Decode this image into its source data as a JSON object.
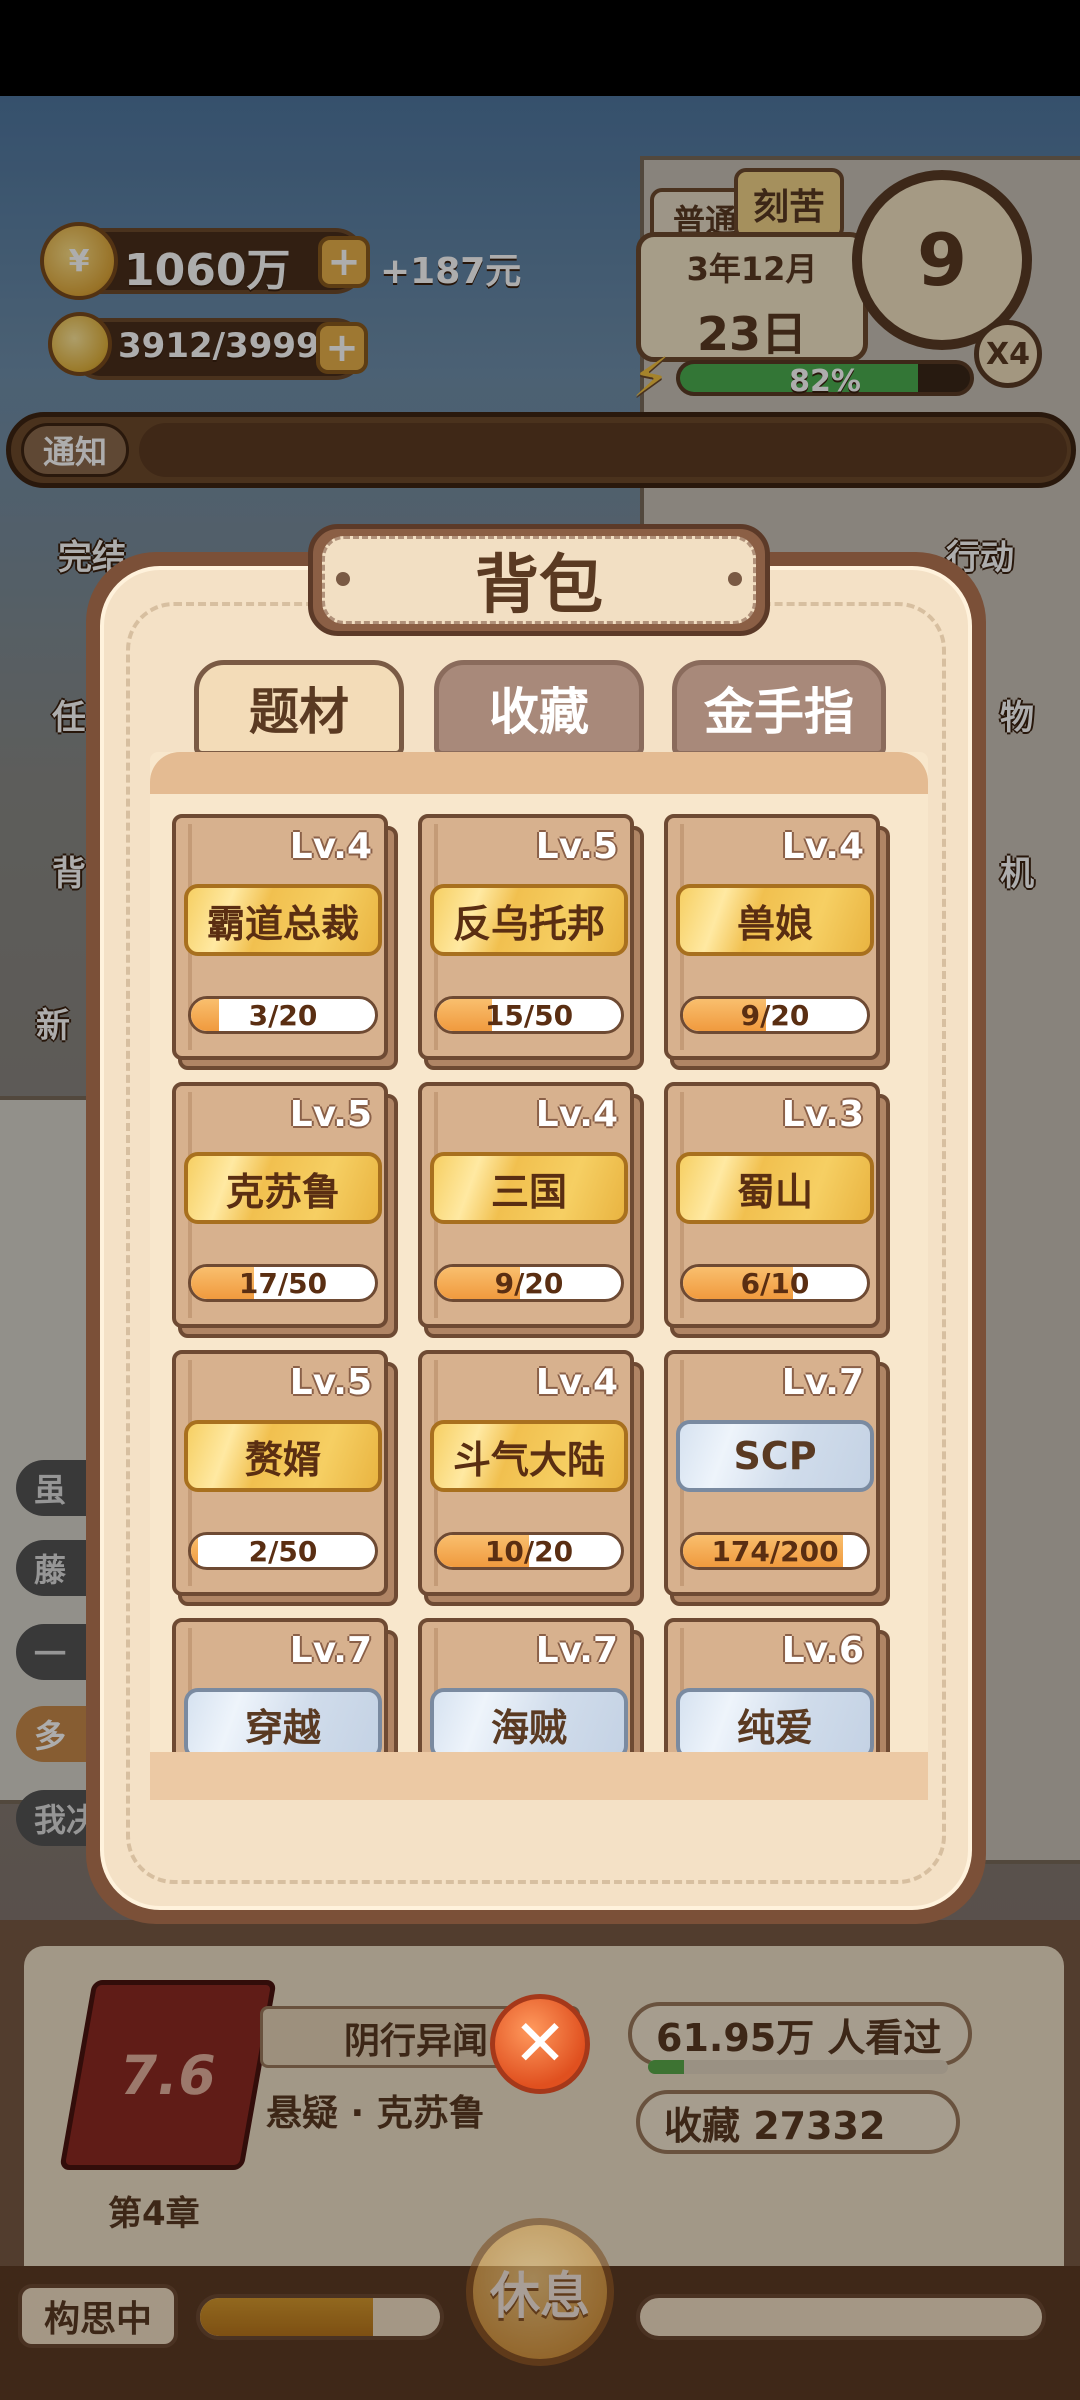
{
  "hud": {
    "money": "1060万",
    "money_plus": "+",
    "income": "+187元",
    "inspiration": "3912/3999",
    "inspiration_plus": "+"
  },
  "date_panel": {
    "mode_tab": "普通",
    "mode_active": "刻苦",
    "year_month": "3年12月",
    "day": "23日",
    "clock_hour": "9",
    "speed": "X4",
    "energy_percent": "82%",
    "energy_value": 0.82
  },
  "notice": {
    "label": "通知"
  },
  "side_buttons": {
    "left_finish": "完结",
    "right_action": "行动",
    "left_2": "任",
    "left_3": "背",
    "left_4": "新",
    "right_2": "物",
    "right_3": "机"
  },
  "side_chips": [
    "虽",
    "藤",
    "一",
    "多",
    "我决"
  ],
  "modal": {
    "title": "背包",
    "tabs": [
      {
        "label": "题材",
        "active": true
      },
      {
        "label": "收藏",
        "active": false
      },
      {
        "label": "金手指",
        "active": false
      }
    ],
    "items": [
      {
        "name": "霸道总裁",
        "level": "Lv.4",
        "progress_text": "3/20",
        "progress": 0.15,
        "style": "gold"
      },
      {
        "name": "反乌托邦",
        "level": "Lv.5",
        "progress_text": "15/50",
        "progress": 0.3,
        "style": "gold"
      },
      {
        "name": "兽娘",
        "level": "Lv.4",
        "progress_text": "9/20",
        "progress": 0.45,
        "style": "gold"
      },
      {
        "name": "克苏鲁",
        "level": "Lv.5",
        "progress_text": "17/50",
        "progress": 0.34,
        "style": "gold"
      },
      {
        "name": "三国",
        "level": "Lv.4",
        "progress_text": "9/20",
        "progress": 0.45,
        "style": "gold"
      },
      {
        "name": "蜀山",
        "level": "Lv.3",
        "progress_text": "6/10",
        "progress": 0.6,
        "style": "gold"
      },
      {
        "name": "赘婿",
        "level": "Lv.5",
        "progress_text": "2/50",
        "progress": 0.04,
        "style": "gold"
      },
      {
        "name": "斗气大陆",
        "level": "Lv.4",
        "progress_text": "10/20",
        "progress": 0.5,
        "style": "gold"
      },
      {
        "name": "SCP",
        "level": "Lv.7",
        "progress_text": "174/200",
        "progress": 0.87,
        "style": "blue"
      },
      {
        "name": "穿越",
        "level": "Lv.7",
        "progress_text": "",
        "progress": 0,
        "style": "blue"
      },
      {
        "name": "海贼",
        "level": "Lv.7",
        "progress_text": "",
        "progress": 0,
        "style": "blue"
      },
      {
        "name": "纯爱",
        "level": "Lv.6",
        "progress_text": "",
        "progress": 0,
        "style": "blue"
      }
    ]
  },
  "book": {
    "cover_text": "7.6",
    "title": "阴行异闻",
    "genre": "悬疑 · 克苏鲁",
    "chapter": "第4章",
    "views": "61.95万 人看过",
    "favorites": "收藏 27332"
  },
  "bottom": {
    "status": "构思中",
    "think_progress": 0.72,
    "rest_label": "休息"
  },
  "colors": {
    "modal_bg": "#f4e1c6",
    "progress_fill": "#f09a3e",
    "gold_plate": "#f6cf63",
    "blue_plate": "#d6e2f0"
  }
}
